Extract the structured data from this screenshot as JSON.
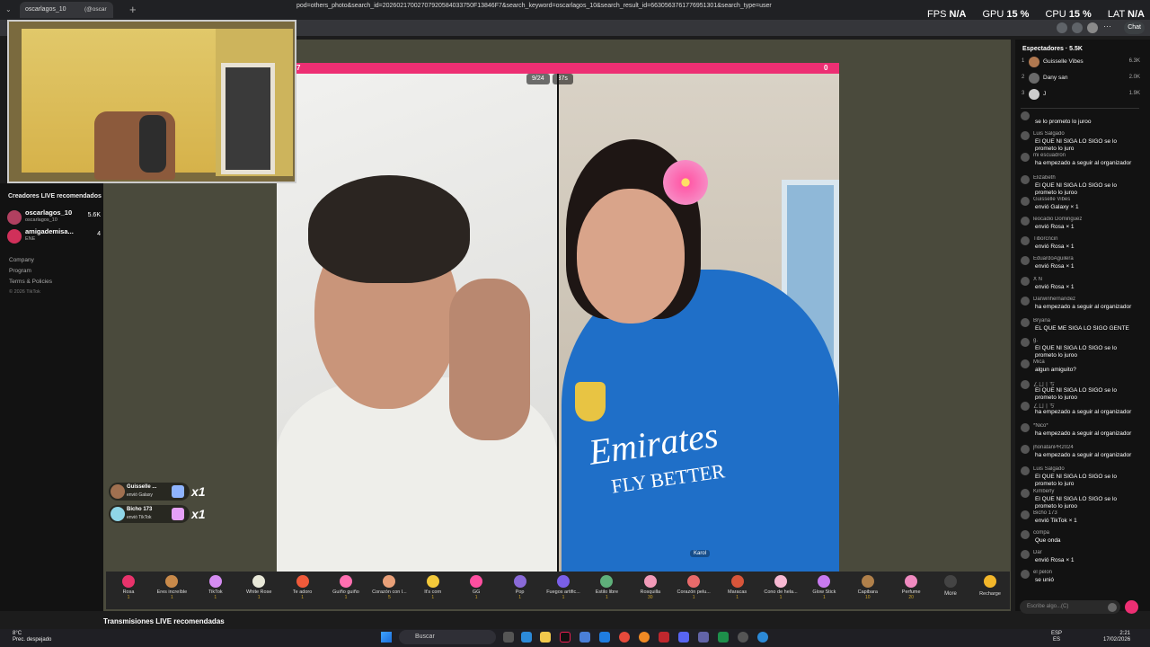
{
  "browser": {
    "tab_active": "oscarlagos_10",
    "tab_second": "(@oscar",
    "url": "pod=others_photo&search_id=20260217002707920584033750F13846F7&search_keyword=oscarlagos_10&search_result_id=6630563761776951301&search_type=user",
    "chat_button": "Chat",
    "new_tab": "+"
  },
  "hud": {
    "fps_label": "FPS",
    "fps": "N/A",
    "gpu_label": "GPU",
    "gpu": "15 %",
    "cpu_label": "CPU",
    "cpu": "15 %",
    "lat_label": "LAT",
    "lat": "N/A"
  },
  "sidebar": {
    "title": "Creadores LIVE recomendados",
    "creators": [
      {
        "name": "oscarlagos_10",
        "sub": "oscarlagos_10",
        "count": "5.6K"
      },
      {
        "name": "amigademisa...",
        "sub": "ENE",
        "count": "4"
      }
    ],
    "links": [
      "Company",
      "Program",
      "Terms & Policies",
      "© 2026 TikTok"
    ]
  },
  "live": {
    "progress_left": "7",
    "progress_right": "0",
    "viewers_pill": "9/24",
    "timer_pill": "37s",
    "guest_name": "Karol",
    "shirt_text": "Emirates",
    "shirt_sub": "FLY BETTER"
  },
  "notices": [
    {
      "name": "Guisselle ...",
      "desc": "envió Galaxy",
      "count": "x1"
    },
    {
      "name": "Bicho 173",
      "desc": "envió TikTok",
      "count": "x1"
    }
  ],
  "gifts": [
    {
      "label": "Rosa",
      "price": "1",
      "color": "#e8336b"
    },
    {
      "label": "Eres increíble",
      "price": "1",
      "color": "#c98a4a"
    },
    {
      "label": "TikTok",
      "price": "1",
      "color": "#d58cf2"
    },
    {
      "label": "White Rose",
      "price": "1",
      "color": "#e8e8d8"
    },
    {
      "label": "Te adoro",
      "price": "1",
      "color": "#f05a3a"
    },
    {
      "label": "Guiño guiño",
      "price": "1",
      "color": "#ff6fb0"
    },
    {
      "label": "Corazón con l...",
      "price": "5",
      "color": "#e9a078"
    },
    {
      "label": "It's corn",
      "price": "1",
      "color": "#f3c93a"
    },
    {
      "label": "GG",
      "price": "1",
      "color": "#ff4fa0"
    },
    {
      "label": "Pop",
      "price": "1",
      "color": "#8a6ad8"
    },
    {
      "label": "Fuegos artific...",
      "price": "1",
      "color": "#7a5fe8"
    },
    {
      "label": "Estilo libre",
      "price": "1",
      "color": "#5fb07a"
    },
    {
      "label": "Rosquilla",
      "price": "30",
      "color": "#f29ab8"
    },
    {
      "label": "Corazón pelu...",
      "price": "1",
      "color": "#e86a6a"
    },
    {
      "label": "Maracas",
      "price": "1",
      "color": "#d8553a"
    },
    {
      "label": "Cono de hela...",
      "price": "1",
      "color": "#f7b8d2"
    },
    {
      "label": "Glow Stick",
      "price": "1",
      "color": "#c87af0"
    },
    {
      "label": "Capibara",
      "price": "10",
      "color": "#b0804a"
    },
    {
      "label": "Perfume",
      "price": "20",
      "color": "#f08ac0"
    }
  ],
  "more_label": "More",
  "recharge_label": "Recharge",
  "section_title": "Transmisiones LIVE recomendadas",
  "chat": {
    "title": "Espectadores · 5.5K",
    "viewers": [
      {
        "rank": "1",
        "name": "Guisselle Vibes",
        "score": "6.3K"
      },
      {
        "rank": "2",
        "name": "Dany san",
        "score": "2.0K"
      },
      {
        "rank": "3",
        "name": "J",
        "score": "1.9K"
      }
    ],
    "messages": [
      {
        "user": "",
        "text": "se lo prometo lo juroo"
      },
      {
        "user": "Luis Salgado",
        "text": "El QUE NI SIGA LO SIGO se lo prometo lo juro"
      },
      {
        "user": "mi escuadrón",
        "text": "ha empezado a seguir al organizador"
      },
      {
        "user": "Elizabeth",
        "text": "El QUE NI SIGA LO SIGO se lo prometo lo juroo"
      },
      {
        "user": "Guisselle Vibes",
        "text": "envió Galaxy × 1"
      },
      {
        "user": "leocadio Dominguez",
        "text": "envió Rosa × 1"
      },
      {
        "user": "Tiborcncin",
        "text": "envió Rosa × 1"
      },
      {
        "user": "EduardoAguilera",
        "text": "envió Rosa × 1"
      },
      {
        "user": "X N",
        "text": "envió Rosa × 1"
      },
      {
        "user": "Darwinhernandez",
        "text": "ha empezado a seguir al organizador"
      },
      {
        "user": "Bryana",
        "text": "EL QUE ME SIGA LO SIGO GENTE"
      },
      {
        "user": "g.",
        "text": "El QUE NI SIGA LO SIGO se lo prometo lo juroo"
      },
      {
        "user": "Mica",
        "text": "algun amiguito?"
      },
      {
        "user": "ㄥㄩ丨ㄎ",
        "text": "El QUE NI SIGA LO SIGO se lo prometo lo juroo"
      },
      {
        "user": "ㄥㄩ丨ㄎ",
        "text": "ha empezado a seguir al organizador"
      },
      {
        "user": "*Nico*",
        "text": "ha empezado a seguir al organizador"
      },
      {
        "user": "jhonatanPR2024",
        "text": "ha empezado a seguir al organizador"
      },
      {
        "user": "Luis Salgado",
        "text": "El QUE NI SIGA LO SIGO se lo prometo lo juro"
      },
      {
        "user": "Kimberly",
        "text": "El QUE NI SIGA LO SIGO se lo prometo lo juroo"
      },
      {
        "user": "Bicho 173",
        "text": "envió TikTok × 1"
      },
      {
        "user": "compa",
        "text": "Que onda"
      },
      {
        "user": "Dar",
        "text": "envió Rosa × 1"
      },
      {
        "user": "el pelon",
        "text": "se unió"
      }
    ],
    "input_placeholder": "Escribe algo...(C)"
  },
  "taskbar": {
    "weather_temp": "8°C",
    "weather_desc": "Prec. despejado",
    "search": "Buscar",
    "lang": "ESP",
    "region": "ES",
    "time": "2:21",
    "date": "17/02/2026"
  },
  "colors": {
    "accent": "#ed2f73",
    "live_bg": "#4a4a3c",
    "chat_bg": "#121212"
  }
}
